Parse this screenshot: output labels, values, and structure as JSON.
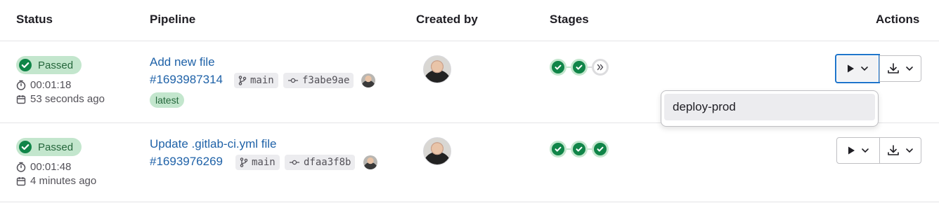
{
  "table": {
    "headers": {
      "status": "Status",
      "pipeline": "Pipeline",
      "created_by": "Created by",
      "stages": "Stages",
      "actions": "Actions"
    }
  },
  "rows": [
    {
      "status": "Passed",
      "duration": "00:01:18",
      "finished": "53 seconds ago",
      "commit_title": "Add new file",
      "pipeline_id": "#1693987314",
      "branch": "main",
      "sha": "f3abe9ae",
      "tag": "latest",
      "stages": [
        "passed",
        "passed",
        "skipped"
      ]
    },
    {
      "status": "Passed",
      "duration": "00:01:48",
      "finished": "4 minutes ago",
      "commit_title": "Update .gitlab-ci.yml file",
      "pipeline_id": "#1693976269",
      "branch": "main",
      "sha": "dfaa3f8b",
      "stages": [
        "passed",
        "passed",
        "passed"
      ]
    }
  ],
  "manual_jobs_dropdown": {
    "items": [
      "deploy-prod"
    ]
  },
  "colors": {
    "success": "#108548",
    "success_bg": "#c3e6cd",
    "link": "#1f62a8",
    "focus": "#1f75cb"
  }
}
